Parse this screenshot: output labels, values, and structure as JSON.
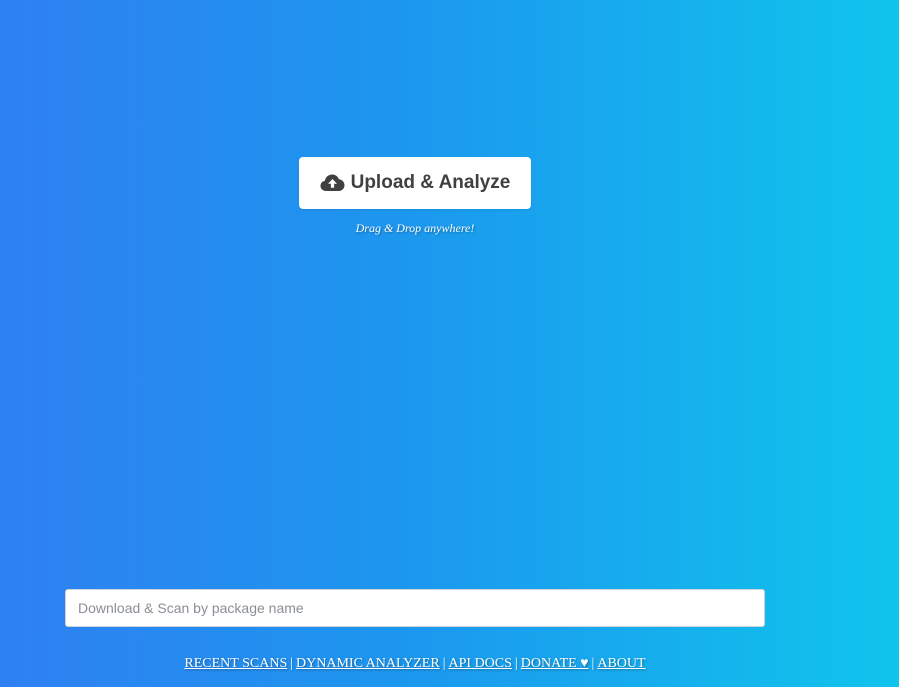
{
  "upload": {
    "button_label": "Upload & Analyze",
    "icon": "cloud-upload-icon",
    "hint": "Drag & Drop anywhere!"
  },
  "package_search": {
    "placeholder": "Download & Scan by package name",
    "value": ""
  },
  "footer": {
    "links": [
      {
        "label": "RECENT SCANS"
      },
      {
        "label": "DYNAMIC ANALYZER"
      },
      {
        "label": "API DOCS"
      },
      {
        "label": "DONATE ♥"
      },
      {
        "label": "ABOUT"
      }
    ],
    "separator": "|"
  },
  "colors": {
    "gradient_start": "#2f80f2",
    "gradient_end": "#10c4ec",
    "button_bg": "#ffffff",
    "button_text": "#404040"
  }
}
